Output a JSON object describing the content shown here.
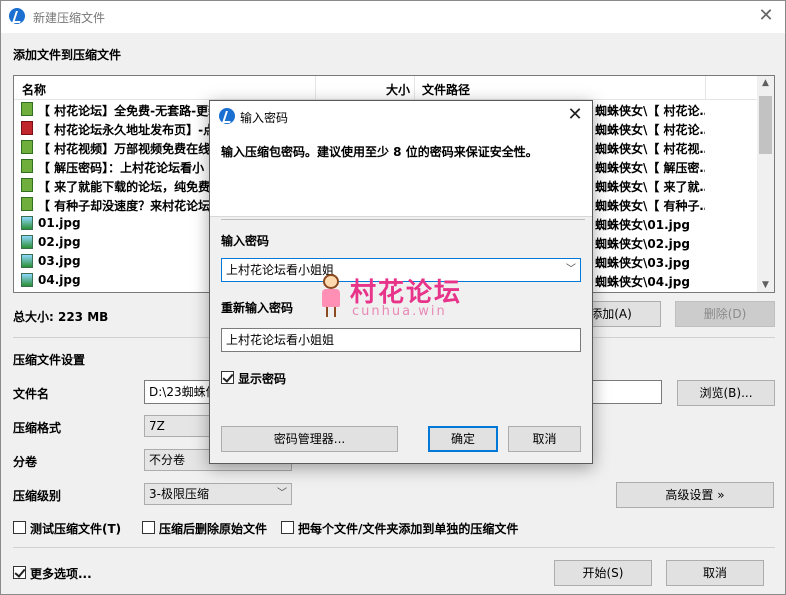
{
  "window": {
    "title": "新建压缩文件",
    "add_files_label": "添加文件到压缩文件",
    "columns": {
      "name": "名称",
      "size": "大小",
      "path": "文件路径"
    },
    "files": [
      {
        "name": "【 村花论坛】全免费-无套路-更新",
        "path": "蜘蛛侠女\\【 村花论…",
        "icon": "green"
      },
      {
        "name": "【 村花论坛永久地址发布页】-点",
        "path": "蜘蛛侠女\\【 村花论…",
        "icon": "red"
      },
      {
        "name": "【 村花视频】万部视频免费在线",
        "path": "蜘蛛侠女\\【 村花视…",
        "icon": "green"
      },
      {
        "name": "【 解压密码】：上村花论坛看小",
        "path": "蜘蛛侠女\\【 解压密…",
        "icon": "green"
      },
      {
        "name": "【 来了就能下载的论坛，纯免费",
        "path": "蜘蛛侠女\\【 来了就…",
        "icon": "green"
      },
      {
        "name": "【 有种子却没速度？来村花论坛，",
        "path": "蜘蛛侠女\\【 有种子…",
        "icon": "green"
      },
      {
        "name": "01.jpg",
        "path": "蜘蛛侠女\\01.jpg",
        "icon": "img"
      },
      {
        "name": "02.jpg",
        "path": "蜘蛛侠女\\02.jpg",
        "icon": "img"
      },
      {
        "name": "03.jpg",
        "path": "蜘蛛侠女\\03.jpg",
        "icon": "img"
      },
      {
        "name": "04.jpg",
        "path": "蜘蛛侠女\\04.jpg",
        "icon": "img"
      }
    ],
    "total_size": "总大小: 223 MB",
    "add_button": "添加(A)",
    "delete_button": "删除(D)",
    "settings_heading": "压缩文件设置",
    "filename_label": "文件名",
    "filename_value": "D:\\23蜘蛛侠",
    "browse_button": "浏览(B)...",
    "format_label": "压缩格式",
    "format_value": "7Z",
    "split_label": "分卷",
    "split_value": "不分卷",
    "level_label": "压缩级别",
    "level_value": "3-极限压缩",
    "advanced_button": "高级设置 »",
    "opt_test": "测试压缩文件(T)",
    "opt_delete": "压缩后删除原始文件",
    "opt_each": "把每个文件/文件夹添加到单独的压缩文件",
    "more_options": "更多选项...",
    "start_button": "开始(S)",
    "cancel_button": "取消"
  },
  "dialog": {
    "title": "输入密码",
    "info": "输入压缩包密码。建议使用至少 8 位的密码来保证安全性。",
    "password_label": "输入密码",
    "password_value": "上村花论坛看小姐姐",
    "reenter_label": "重新输入密码",
    "reenter_value": "上村花论坛看小姐姐",
    "show_password_label": "显示密码",
    "show_password_checked": true,
    "manager_button": "密码管理器...",
    "ok_button": "确定",
    "cancel_button": "取消"
  },
  "watermark": {
    "title": "村花论坛",
    "subtitle": "cunhua.win"
  },
  "colors": {
    "accent": "#0078d7",
    "watermark": "#e8338a"
  }
}
